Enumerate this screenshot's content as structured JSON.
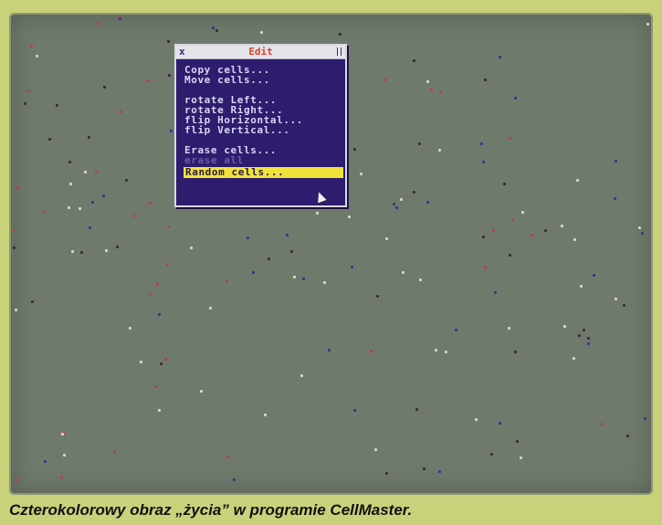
{
  "window": {
    "title": "Edit",
    "close_glyph": "x"
  },
  "menu": {
    "items": [
      {
        "label": "Copy cells...",
        "state": "normal"
      },
      {
        "label": "Move cells...",
        "state": "normal"
      },
      {
        "label": "",
        "state": "separator"
      },
      {
        "label": "rotate Left...",
        "state": "normal"
      },
      {
        "label": "rotate Right...",
        "state": "normal"
      },
      {
        "label": "flip Horizontal...",
        "state": "normal"
      },
      {
        "label": "flip Vertical...",
        "state": "normal"
      },
      {
        "label": "",
        "state": "separator"
      },
      {
        "label": "Erase cells...",
        "state": "normal"
      },
      {
        "label": "erase all",
        "state": "disabled"
      },
      {
        "label": "Random cells...",
        "state": "selected"
      }
    ]
  },
  "caption": {
    "text": "Czterokolorowy obraz „życia” w programie CellMaster."
  },
  "colors": {
    "background": "#c9d27a",
    "screen": "#6f7a6c",
    "menu_bg": "#2e1c6e",
    "highlight": "#f0e23a",
    "title": "#e0402a"
  },
  "icons": {
    "close": "close-icon",
    "cursor": "mouse-pointer-icon",
    "resize": "resize-handle-icon"
  }
}
